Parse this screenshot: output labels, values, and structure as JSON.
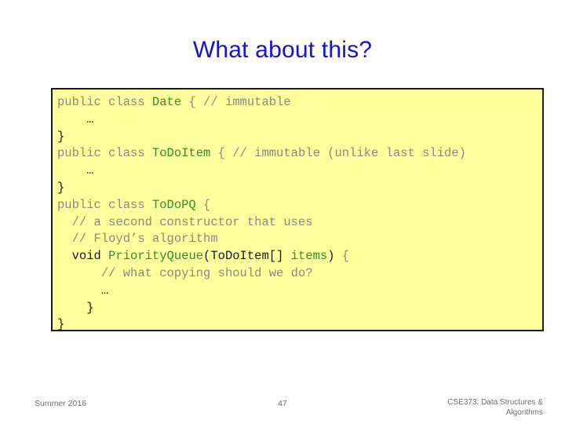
{
  "slide": {
    "title": "What about this?",
    "title_color": "#1414C8",
    "page_number": "47"
  },
  "code_block": {
    "background_color": "#FFFF9E",
    "border_color": "#1A1A1A",
    "language": "java",
    "colors": {
      "keyword": "#8A8A80",
      "class_name": "#2F8F2F",
      "comment": "#8A8A80",
      "plain": "#1A1A1A"
    },
    "lines": [
      {
        "id": "line-1",
        "indent": 0,
        "tokens": [
          {
            "text": "public class ",
            "kind": "kw"
          },
          {
            "text": "Date",
            "kind": "cls"
          },
          {
            "text": " { ",
            "kind": "punct"
          },
          {
            "text": "// immutable",
            "kind": "cmt"
          }
        ]
      },
      {
        "id": "line-2",
        "indent": 2,
        "tokens": [
          {
            "text": "…",
            "kind": "ell"
          }
        ]
      },
      {
        "id": "line-3",
        "indent": 0,
        "tokens": [
          {
            "text": "}",
            "kind": "plain"
          }
        ]
      },
      {
        "id": "line-4",
        "indent": 0,
        "tokens": [
          {
            "text": "public class ",
            "kind": "kw"
          },
          {
            "text": "ToDoItem",
            "kind": "cls"
          },
          {
            "text": " { ",
            "kind": "punct"
          },
          {
            "text": "// immutable ",
            "kind": "cmt"
          },
          {
            "text": "(unlike last slide)",
            "kind": "punct"
          }
        ]
      },
      {
        "id": "line-5",
        "indent": 2,
        "tokens": [
          {
            "text": "…",
            "kind": "ell"
          }
        ]
      },
      {
        "id": "line-6",
        "indent": 0,
        "tokens": [
          {
            "text": "}",
            "kind": "plain"
          }
        ]
      },
      {
        "id": "line-7",
        "indent": 0,
        "tokens": [
          {
            "text": "public class ",
            "kind": "kw"
          },
          {
            "text": "ToDoPQ",
            "kind": "cls"
          },
          {
            "text": " {",
            "kind": "punct"
          }
        ]
      },
      {
        "id": "line-8",
        "indent": 1,
        "tokens": [
          {
            "text": "// a second constructor that uses",
            "kind": "cmt"
          }
        ]
      },
      {
        "id": "line-9",
        "indent": 1,
        "tokens": [
          {
            "text": "// Floyd’s algorithm",
            "kind": "cmt"
          }
        ]
      },
      {
        "id": "line-10",
        "indent": 1,
        "tokens": [
          {
            "text": "void ",
            "kind": "plain"
          },
          {
            "text": "PriorityQueue",
            "kind": "cls"
          },
          {
            "text": "(ToDoItem[] ",
            "kind": "plain"
          },
          {
            "text": "items",
            "kind": "cls"
          },
          {
            "text": ") ",
            "kind": "plain"
          },
          {
            "text": "{",
            "kind": "punct"
          }
        ]
      },
      {
        "id": "line-11",
        "indent": 3,
        "tokens": [
          {
            "text": "// what copying should we do?",
            "kind": "cmt"
          }
        ]
      },
      {
        "id": "line-12",
        "indent": 3,
        "tokens": [
          {
            "text": "…",
            "kind": "ell"
          }
        ]
      },
      {
        "id": "line-13",
        "indent": 2,
        "tokens": [
          {
            "text": "}",
            "kind": "plain"
          }
        ]
      },
      {
        "id": "line-14",
        "indent": 0,
        "tokens": [
          {
            "text": "}",
            "kind": "plain"
          }
        ]
      }
    ]
  },
  "footer": {
    "left": "Summer 2016",
    "center": "47",
    "right_line1": "CSE373: Data Structures &",
    "right_line2": "Algorithms"
  }
}
